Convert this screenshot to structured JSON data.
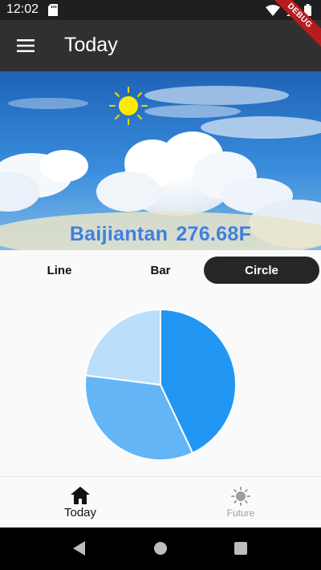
{
  "status_bar": {
    "time": "12:02"
  },
  "debug_banner": "DEBUG",
  "app_bar": {
    "title": "Today"
  },
  "hero": {
    "city": "Baijiantan",
    "temperature": "276.68F"
  },
  "chart_tabs": [
    {
      "label": "Line",
      "active": false
    },
    {
      "label": "Bar",
      "active": false
    },
    {
      "label": "Circle",
      "active": true
    }
  ],
  "chart_data": {
    "type": "pie",
    "slices": [
      {
        "value": 43,
        "color": "#2196f3"
      },
      {
        "value": 34,
        "color": "#64b5f6"
      },
      {
        "value": 23,
        "color": "#bbdefb"
      }
    ],
    "start_angle_deg": 0,
    "title": "",
    "legend": "none"
  },
  "bottom_nav": [
    {
      "label": "Today",
      "icon": "home-icon",
      "active": true
    },
    {
      "label": "Future",
      "icon": "sun-icon",
      "active": false
    }
  ],
  "colors": {
    "accent": "#2196f3",
    "app_bar": "#303030",
    "city_text": "#3f7fe0"
  }
}
